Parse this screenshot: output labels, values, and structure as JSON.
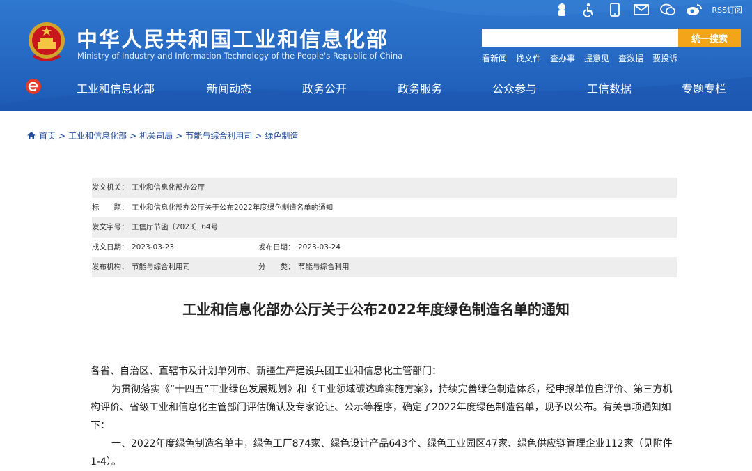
{
  "header": {
    "title_cn": "中华人民共和国工业和信息化部",
    "title_en": "Ministry of Industry and Information Technology of the People's Republic of China",
    "rss_label": "RSS订阅",
    "search": {
      "placeholder": "",
      "button_label": "统一搜索"
    },
    "quick_links": [
      "看新闻",
      "找文件",
      "查办事",
      "提意见",
      "查数据",
      "要投诉"
    ],
    "accent_color": "#f3a418",
    "nav_color": "#2568c2"
  },
  "nav": {
    "items": [
      "工业和信息化部",
      "新闻动态",
      "政务公开",
      "政务服务",
      "公众参与",
      "工信数据",
      "专题专栏"
    ]
  },
  "breadcrumb": [
    "首页",
    "工业和信息化部",
    "机关司局",
    "节能与综合利用司",
    "绿色制造"
  ],
  "meta": {
    "issuer_label": "发文机关：",
    "issuer": "工业和信息化部办公厅",
    "subject_label": "标　　题：",
    "subject": "工业和信息化部办公厅关于公布2022年度绿色制造名单的通知",
    "docno_label": "发文字号：",
    "docno": "工信厅节函〔2023〕64号",
    "created_label": "成文日期：",
    "created": "2023-03-23",
    "published_label": "发布日期：",
    "published": "2023-03-24",
    "publisher_label": "发布机构：",
    "publisher": "节能与综合利用司",
    "category_label": "分　　类：",
    "category": "节能与综合利用"
  },
  "article": {
    "title": "工业和信息化部办公厅关于公布2022年度绿色制造名单的通知",
    "salutation": "各省、自治区、直辖市及计划单列市、新疆生产建设兵团工业和信息化主管部门：",
    "para1": "为贯彻落实《“十四五”工业绿色发展规划》和《工业领域碳达峰实施方案》，持续完善绿色制造体系，经申报单位自评价、第三方机构评价、省级工业和信息化主管部门评估确认及专家论证、公示等程序，确定了2022年度绿色制造名单，现予以公布。有关事项通知如下：",
    "para2": "一、2022年度绿色制造名单中，绿色工厂874家、绿色设计产品643个、绿色工业园区47家、绿色供应链管理企业112家（见附件1-4）。"
  }
}
